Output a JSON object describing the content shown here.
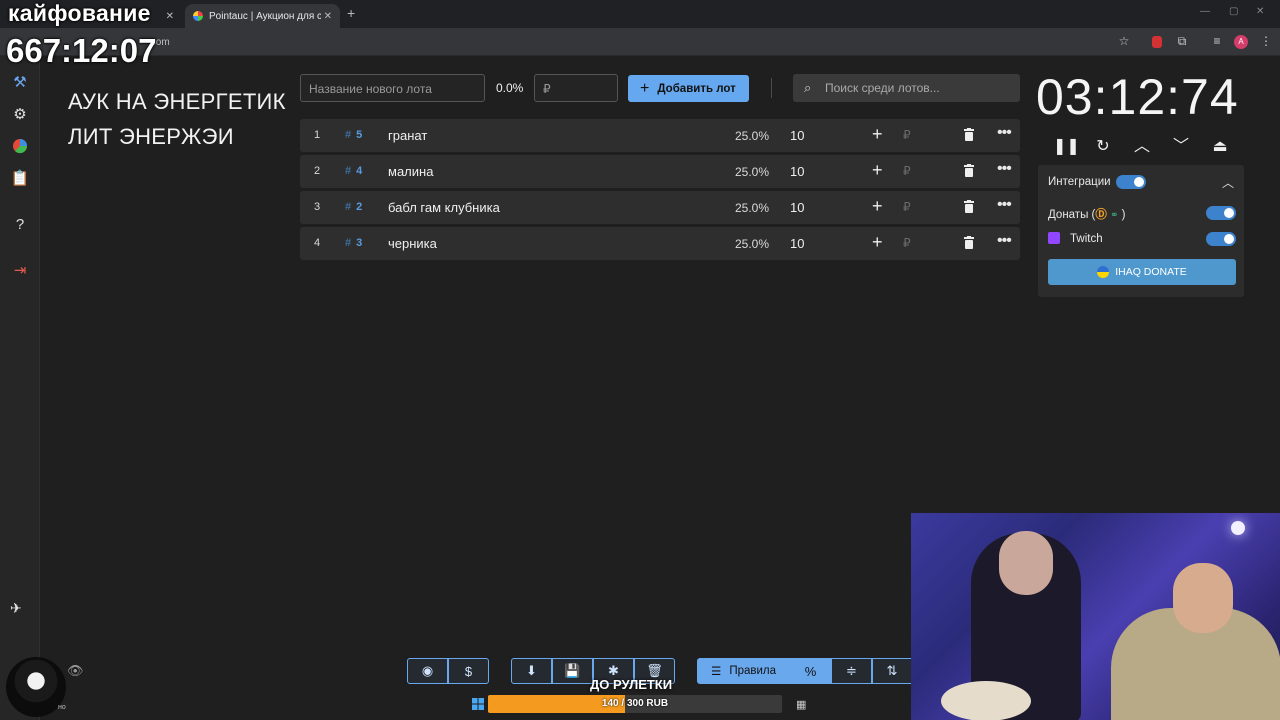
{
  "overlay": {
    "channel_text": "кайфование",
    "stream_timer": "667:12:07"
  },
  "browser": {
    "tab_title": "Pointauc | Аукцион для стрим...",
    "url_visible": ".com",
    "profile_letter": "A"
  },
  "app": {
    "auction_title": "АУК НА ЭНЕРГЕТИК ЛИТ ЭНЕРЖЭИ",
    "new_lot_placeholder": "Название нового лота",
    "new_lot_percent": "0.0%",
    "amount_placeholder": "₽",
    "add_lot_label": "Добавить лот",
    "search_placeholder": "Поиск среди лотов...",
    "lots": [
      {
        "index": "1",
        "id": "5",
        "name": "гранат",
        "percent": "25.0%",
        "amount": "10"
      },
      {
        "index": "2",
        "id": "4",
        "name": "малина",
        "percent": "25.0%",
        "amount": "10"
      },
      {
        "index": "3",
        "id": "2",
        "name": "бабл гам клубника",
        "percent": "25.0%",
        "amount": "10"
      },
      {
        "index": "4",
        "id": "3",
        "name": "черника",
        "percent": "25.0%",
        "amount": "10"
      }
    ],
    "timer": "03:12:74",
    "integrations": {
      "header": "Интеграции",
      "donations_label": "Донаты (",
      "donations_suffix": ")",
      "twitch_label": "Twitch",
      "donate_button": "IHAQ DONATE"
    },
    "bottom": {
      "rules_label": "Правила",
      "roulette_title": "ДО РУЛЕТКИ",
      "roulette_text": "140 / 300 RUB",
      "roulette_progress": 0.4667,
      "tiny_text": "но"
    }
  },
  "colors": {
    "accent": "#6aa8ee",
    "progress": "#f39a1f",
    "twitch": "#9146ff"
  }
}
